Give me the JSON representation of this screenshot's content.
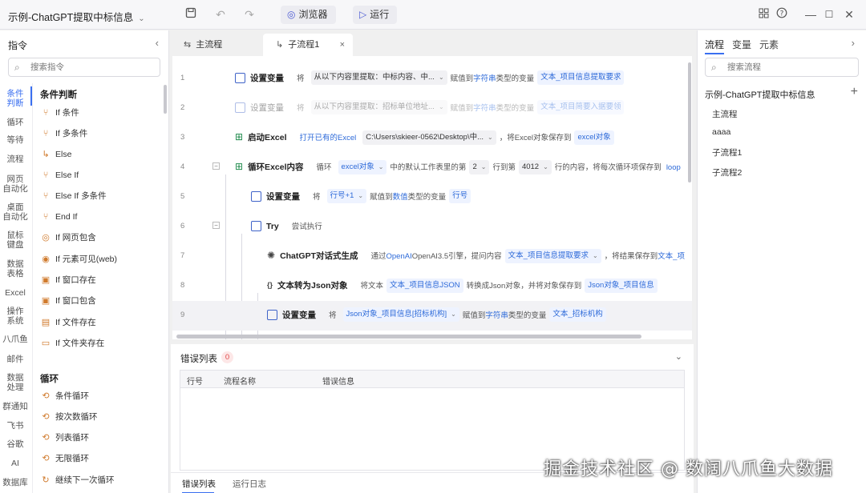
{
  "title_bar": {
    "app_title": "示例-ChatGPT提取中标信息",
    "browser_label": "浏览器",
    "run_label": "运行"
  },
  "left_panel": {
    "title": "指令",
    "search_placeholder": "搜索指令",
    "categories": [
      "条件\n判断",
      "循环",
      "等待",
      "流程",
      "网页\n自动化",
      "桌面\n自动化",
      "鼠标\n键盘",
      "数据\n表格",
      "Excel",
      "操作\n系统",
      "八爪鱼",
      "邮件",
      "数据\n处理",
      "群通知",
      "飞书",
      "谷歌",
      "AI",
      "数据库"
    ],
    "sections": [
      {
        "title": "条件判断",
        "items": [
          "If 条件",
          "If 多条件",
          "Else",
          "Else If",
          "Else If 多条件",
          "End If",
          "If 网页包含",
          "If 元素可见(web)",
          "If 窗口存在",
          "If 窗口包含",
          "If 文件存在",
          "If 文件夹存在"
        ]
      },
      {
        "title": "循环",
        "items": [
          "条件循环",
          "按次数循环",
          "列表循环",
          "无限循环",
          "继续下一次循环"
        ]
      }
    ]
  },
  "tabs": [
    {
      "label": "主流程"
    },
    {
      "label": "子流程1"
    }
  ],
  "flow": {
    "rows": [
      {
        "num": "1",
        "name": "设置变量",
        "p1": "将",
        "c1": "从以下内容里提取：中标内容、中...",
        "p2": "赋值到",
        "lk1": "字符串",
        "p3": "类型的变量",
        "c2": "文本_项目信息提取要求"
      },
      {
        "num": "2",
        "name": "设置变量",
        "p1": "将",
        "c1": "从以下内容里提取：招标单位地址...",
        "p2": "赋值到",
        "lk1": "字符串",
        "p3": "类型的变量",
        "c2": "文本_项目简要入据要领"
      },
      {
        "num": "3",
        "name": "启动Excel",
        "lk1": "打开已有的Excel",
        "c1": "C:\\Users\\skieer-0562\\Desktop\\中...",
        "p2": "，将Excel对象保存到",
        "c2": "excel对象"
      },
      {
        "num": "4",
        "name": "循环Excel内容",
        "p1": "循环",
        "c1": "excel对象",
        "p2": "中的默认工作表里的第",
        "c2": "2",
        "p3": "行到第",
        "c3": "4012",
        "p4": "行的内容，将每次循环项保存到",
        "lk1": "loop"
      },
      {
        "num": "5",
        "name": "设置变量",
        "p1": "将",
        "c1": "行号+1",
        "p2": "赋值到",
        "lk1": "数值",
        "p3": "类型的变量",
        "c2": "行号"
      },
      {
        "num": "6",
        "name": "Try",
        "p1": "尝试执行"
      },
      {
        "num": "7",
        "name": "ChatGPT对话式生成",
        "p1": "通过",
        "lk1": "OpenAI",
        "p2": "OpenAI3.5引擎，提问内容",
        "c1": "文本_项目信息提取要求",
        "p3": "，将结果保存到",
        "lk2": "文本_项"
      },
      {
        "num": "8",
        "name": "文本转为Json对象",
        "p1": "将文本",
        "c1": "文本_项目信息JSON",
        "p2": "转换成Json对象，并将对象保存到",
        "c2": "Json对象_项目信息"
      },
      {
        "num": "9",
        "name": "设置变量",
        "p1": "将",
        "c1": "Json对象_项目信息[招标机构]",
        "p2": "赋值到",
        "lk1": "字符串",
        "p3": "类型的变量",
        "c2": "文本_招标机构"
      }
    ]
  },
  "errors": {
    "title": "错误列表",
    "count": "0",
    "columns": [
      "行号",
      "流程名称",
      "错误信息"
    ],
    "bottom_tabs": [
      "错误列表",
      "运行日志"
    ]
  },
  "right_panel": {
    "tabs": [
      "流程",
      "变量",
      "元素"
    ],
    "search_placeholder": "搜索流程",
    "root": "示例-ChatGPT提取中标信息",
    "items": [
      "主流程",
      "aaaa",
      "子流程1",
      "子流程2"
    ]
  },
  "watermark": "掘金技术社区 @ 数阔八爪鱼大数据",
  "colors": {
    "accent": "#3a6ff0",
    "chip_bg": "#eef3ff",
    "chip_text": "#2d6ad9"
  }
}
